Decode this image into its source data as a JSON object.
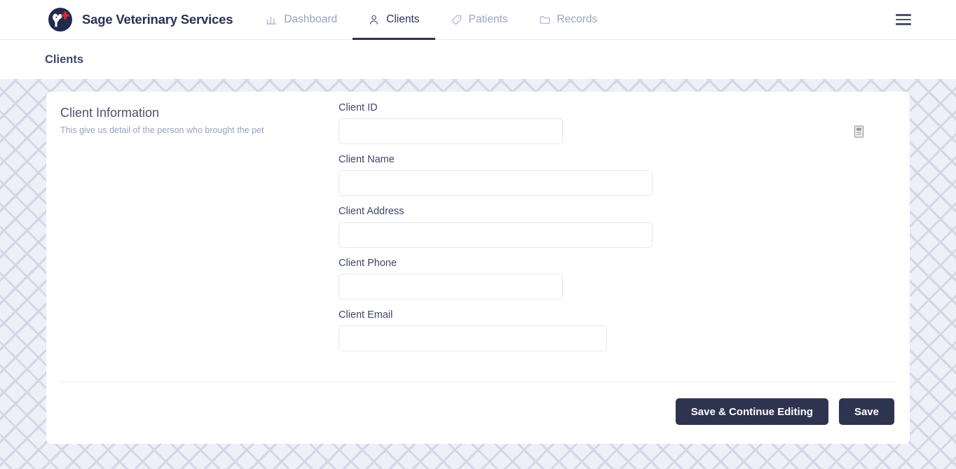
{
  "app": {
    "brand_name": "Sage Veterinary Services",
    "logo_icon": "veterinary-pet-cross-logo",
    "menu_icon": "hamburger-menu-icon",
    "brand_color": "#2b3154",
    "accent_red": "#e02b2b",
    "page_pattern_color": "#d3d6e4",
    "page_bg_color": "#eef0f8"
  },
  "nav": {
    "items": [
      {
        "label": "Dashboard",
        "icon": "bar-chart-icon",
        "active": false
      },
      {
        "label": "Clients",
        "icon": "person-icon",
        "active": true
      },
      {
        "label": "Patients",
        "icon": "tag-icon",
        "active": false
      },
      {
        "label": "Records",
        "icon": "folder-icon",
        "active": false
      }
    ]
  },
  "breadcrumb": {
    "title": "Clients"
  },
  "section": {
    "title": "Client Information",
    "subtitle": "This give us detail of the person who brought the pet"
  },
  "form": {
    "fields": [
      {
        "label": "Client ID",
        "value": "",
        "placeholder": "",
        "name": "client-id",
        "width": "w-clientid",
        "icon": "number-spinner-icon"
      },
      {
        "label": "Client Name",
        "value": "",
        "placeholder": "",
        "name": "client-name",
        "width": "w-name",
        "icon": ""
      },
      {
        "label": "Client Address",
        "value": "",
        "placeholder": "",
        "name": "client-address",
        "width": "w-address",
        "icon": ""
      },
      {
        "label": "Client Phone",
        "value": "",
        "placeholder": "",
        "name": "client-phone",
        "width": "w-phone",
        "icon": ""
      },
      {
        "label": "Client Email",
        "value": "",
        "placeholder": "",
        "name": "client-email",
        "width": "w-email",
        "icon": ""
      }
    ]
  },
  "actions": {
    "save_continue_label": "Save & Continue Editing",
    "save_label": "Save",
    "button_color": "#2e3450"
  }
}
